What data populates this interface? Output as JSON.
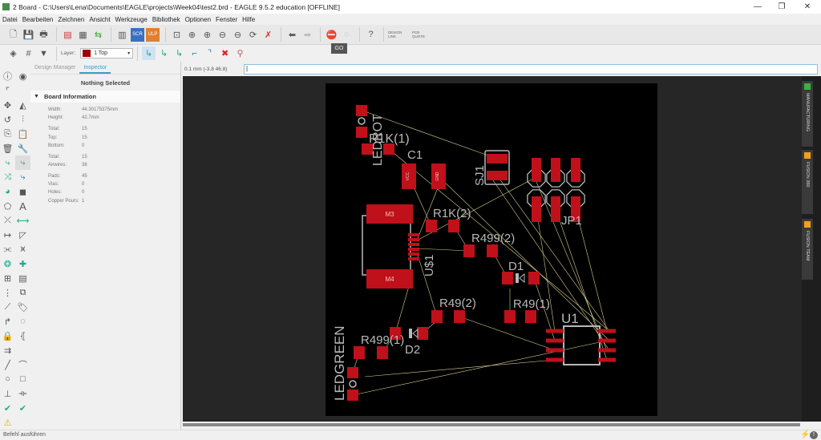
{
  "window": {
    "title": "2 Board - C:\\Users\\Lena\\Documents\\EAGLE\\projects\\Week04\\test2.brd - EAGLE 9.5.2 education [OFFLINE]",
    "minimize": "—",
    "maximize": "❐",
    "close": "✕"
  },
  "menu": [
    "Datei",
    "Bearbeiten",
    "Zeichnen",
    "Ansicht",
    "Werkzeuge",
    "Bibliothek",
    "Optionen",
    "Fenster",
    "Hilfe"
  ],
  "toolbar": {
    "design_link": "DESIGN LINK",
    "pcb_quote": "PCB QUOTE",
    "tooltip": "GO",
    "layer_label": "Layer:",
    "layer_value": "1 Top",
    "layer_color": "#a00000"
  },
  "panel": {
    "tabs": [
      "Design Manager",
      "Inspector"
    ],
    "active_tab": "Inspector",
    "nothing_selected": "Nothing Selected",
    "section": "Board Information",
    "rows": [
      {
        "k": "Width:",
        "v": "44.30175375mm"
      },
      {
        "k": "Height:",
        "v": "42.7mm"
      },
      null,
      {
        "k": "Total:",
        "v": "15"
      },
      {
        "k": "Top:",
        "v": "15"
      },
      {
        "k": "Bottom:",
        "v": "0"
      },
      null,
      {
        "k": "Total:",
        "v": "15"
      },
      {
        "k": "Airwires:",
        "v": "38"
      },
      null,
      {
        "k": "Pads:",
        "v": "45"
      },
      {
        "k": "Vias:",
        "v": "0"
      },
      {
        "k": "Holes:",
        "v": "0"
      },
      {
        "k": "Copper Pours:",
        "v": "1"
      }
    ]
  },
  "coord": "0.1 mm (-3.8 46.8)",
  "command_value": "|",
  "right_tabs": [
    {
      "label": "MANUFACTURING",
      "color": "#3cb043"
    },
    {
      "label": "FUSION 360",
      "color": "#f0a020"
    },
    {
      "label": "FUSION TEAM",
      "color": "#f0a020"
    }
  ],
  "status": "Befehl ausführen",
  "board": {
    "labels": {
      "ledrot": "LEDROT",
      "r1k1": "R1K(1)",
      "c1": "C1",
      "sj1": "SJ1",
      "jp1": "JP1",
      "r1k2": "R1K(2)",
      "us1": "U$1",
      "r4992": "R499(2)",
      "d1": "D1",
      "r492": "R49(2)",
      "r491": "R49(1)",
      "u1": "U1",
      "r4991": "R499(1)",
      "d2": "D2",
      "ledgreen": "LEDGREEN"
    },
    "pads": {
      "m3": "M3",
      "m4": "M4",
      "vcc": "VCC",
      "gnd": "GND"
    },
    "colors": {
      "pad": "#c0101a",
      "silk": "#b8b8b8",
      "airwire": "#d8d090",
      "board": "#000000"
    }
  }
}
